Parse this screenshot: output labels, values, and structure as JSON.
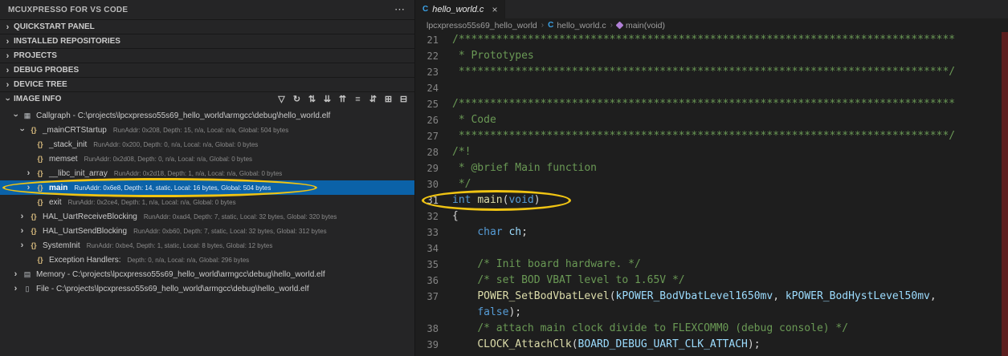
{
  "colors": {
    "selection_blue": "#0b62a8",
    "annotation_yellow": "#f0c413",
    "comment_green": "#6a9955",
    "keyword_blue": "#569cd6",
    "function_yellow": "#dcdcaa",
    "variable_blue": "#9cdcfe",
    "overview_strip_red": "#5c1f1f"
  },
  "sidebar": {
    "title": "MCUXPRESSO FOR VS CODE",
    "more_actions": "⋯",
    "sections": [
      {
        "label": "QUICKSTART PANEL",
        "expanded": false
      },
      {
        "label": "INSTALLED REPOSITORIES",
        "expanded": false
      },
      {
        "label": "PROJECTS",
        "expanded": false
      },
      {
        "label": "DEBUG PROBES",
        "expanded": false
      },
      {
        "label": "DEVICE TREE",
        "expanded": false
      },
      {
        "label": "IMAGE INFO",
        "expanded": true
      }
    ],
    "image_info_toolbar": [
      {
        "name": "filter-icon",
        "glyph": "▽"
      },
      {
        "name": "refresh-icon",
        "glyph": "↻"
      },
      {
        "name": "sort-by-address-icon",
        "glyph": "⇅"
      },
      {
        "name": "sort-descending-icon",
        "glyph": "⇊"
      },
      {
        "name": "sort-ascending-icon",
        "glyph": "⇈"
      },
      {
        "name": "flat-view-icon",
        "glyph": "≡"
      },
      {
        "name": "toggle-sort-icon",
        "glyph": "⇵"
      },
      {
        "name": "expand-all-icon",
        "glyph": "⊞"
      },
      {
        "name": "collapse-all-icon",
        "glyph": "⊟"
      }
    ],
    "tree": [
      {
        "depth": 0,
        "chevron": "expanded",
        "icon": "callgraph",
        "label": "Callgraph - C:\\projects\\lpcxpresso55s69_hello_world\\armgcc\\debug\\hello_world.elf",
        "detail": ""
      },
      {
        "depth": 1,
        "chevron": "expanded",
        "icon": "braces",
        "label": "_mainCRTStartup",
        "detail": "RunAddr: 0x208, Depth: 15, n/a, Local: n/a, Global: 504 bytes"
      },
      {
        "depth": 2,
        "chevron": "none",
        "icon": "braces",
        "label": "_stack_init",
        "detail": "RunAddr: 0x200, Depth: 0, n/a, Local: n/a, Global: 0 bytes"
      },
      {
        "depth": 2,
        "chevron": "none",
        "icon": "braces",
        "label": "memset",
        "detail": "RunAddr: 0x2d08, Depth: 0, n/a, Local: n/a, Global: 0 bytes"
      },
      {
        "depth": 2,
        "chevron": "collapsed",
        "icon": "braces",
        "label": "__libc_init_array",
        "detail": "RunAddr: 0x2d18, Depth: 1, n/a, Local: n/a, Global: 0 bytes"
      },
      {
        "depth": 2,
        "chevron": "collapsed",
        "icon": "braces",
        "label": "main",
        "detail": "RunAddr: 0x6e8, Depth: 14, static, Local: 16 bytes, Global: 504 bytes",
        "selected": true,
        "annotated": true
      },
      {
        "depth": 2,
        "chevron": "none",
        "icon": "braces",
        "label": "exit",
        "detail": "RunAddr: 0x2ce4, Depth: 1, n/a, Local: n/a, Global: 0 bytes"
      },
      {
        "depth": 1,
        "chevron": "collapsed",
        "icon": "braces",
        "label": "HAL_UartReceiveBlocking",
        "detail": "RunAddr: 0xad4, Depth: 7, static, Local: 32 bytes, Global: 320 bytes"
      },
      {
        "depth": 1,
        "chevron": "collapsed",
        "icon": "braces",
        "label": "HAL_UartSendBlocking",
        "detail": "RunAddr: 0xb60, Depth: 7, static, Local: 32 bytes, Global: 312 bytes"
      },
      {
        "depth": 1,
        "chevron": "collapsed",
        "icon": "braces",
        "label": "SystemInit",
        "detail": "RunAddr: 0xbe4, Depth: 1, static, Local: 8 bytes, Global: 12 bytes"
      },
      {
        "depth": 2,
        "chevron": "none",
        "icon": "braces",
        "label": "Exception Handlers:",
        "detail": "Depth: 0, n/a, Local: n/a, Global: 296 bytes"
      },
      {
        "depth": 0,
        "chevron": "collapsed",
        "icon": "memory",
        "label": "Memory - C:\\projects\\lpcxpresso55s69_hello_world\\armgcc\\debug\\hello_world.elf",
        "detail": ""
      },
      {
        "depth": 0,
        "chevron": "collapsed",
        "icon": "file",
        "label": "File - C:\\projects\\lpcxpresso55s69_hello_world\\armgcc\\debug\\hello_world.elf",
        "detail": ""
      }
    ]
  },
  "editor": {
    "tab": {
      "icon": "C",
      "label": "hello_world.c",
      "close": "×"
    },
    "breadcrumb": [
      {
        "icon": "none",
        "label": "lpcxpresso55s69_hello_world"
      },
      {
        "icon": "c",
        "label": "hello_world.c"
      },
      {
        "icon": "method",
        "label": "main(void)"
      }
    ],
    "lines": [
      {
        "num": "21",
        "tokens": [
          [
            "cm",
            "/*******************************************************************************"
          ]
        ]
      },
      {
        "num": "22",
        "tokens": [
          [
            "cm",
            " * Prototypes"
          ]
        ]
      },
      {
        "num": "23",
        "tokens": [
          [
            "cm",
            " ******************************************************************************/"
          ]
        ]
      },
      {
        "num": "24",
        "tokens": []
      },
      {
        "num": "25",
        "tokens": [
          [
            "cm",
            "/*******************************************************************************"
          ]
        ]
      },
      {
        "num": "26",
        "tokens": [
          [
            "cm",
            " * Code"
          ]
        ]
      },
      {
        "num": "27",
        "tokens": [
          [
            "cm",
            " ******************************************************************************/"
          ]
        ]
      },
      {
        "num": "28",
        "tokens": [
          [
            "cm",
            "/*!"
          ]
        ]
      },
      {
        "num": "29",
        "tokens": [
          [
            "cm",
            " * @brief Main function"
          ]
        ]
      },
      {
        "num": "30",
        "tokens": [
          [
            "cm",
            " */"
          ]
        ]
      },
      {
        "num": "31",
        "current": true,
        "annotated": true,
        "tokens": [
          [
            "kw",
            "int"
          ],
          [
            "df",
            " "
          ],
          [
            "fn",
            "main"
          ],
          [
            "df",
            "("
          ],
          [
            "kw",
            "void"
          ],
          [
            "df",
            ")"
          ]
        ]
      },
      {
        "num": "32",
        "tokens": [
          [
            "df",
            "{"
          ]
        ]
      },
      {
        "num": "33",
        "tokens": [
          [
            "df",
            "    "
          ],
          [
            "kw",
            "char"
          ],
          [
            "df",
            " "
          ],
          [
            "var",
            "ch"
          ],
          [
            "df",
            ";"
          ]
        ]
      },
      {
        "num": "34",
        "tokens": []
      },
      {
        "num": "35",
        "tokens": [
          [
            "df",
            "    "
          ],
          [
            "cm",
            "/* Init board hardware. */"
          ]
        ]
      },
      {
        "num": "36",
        "tokens": [
          [
            "df",
            "    "
          ],
          [
            "cm",
            "/* set BOD VBAT level to 1.65V */"
          ]
        ]
      },
      {
        "num": "37",
        "tokens": [
          [
            "df",
            "    "
          ],
          [
            "fn",
            "POWER_SetBodVbatLevel"
          ],
          [
            "df",
            "("
          ],
          [
            "var",
            "kPOWER_BodVbatLevel1650mv"
          ],
          [
            "df",
            ", "
          ],
          [
            "var",
            "kPOWER_BodHystLevel50mv"
          ],
          [
            "df",
            ","
          ]
        ]
      },
      {
        "num": "",
        "wrap": true,
        "tokens": [
          [
            "df",
            "    "
          ],
          [
            "kw",
            "false"
          ],
          [
            "df",
            ");"
          ]
        ]
      },
      {
        "num": "38",
        "tokens": [
          [
            "df",
            "    "
          ],
          [
            "cm",
            "/* attach main clock divide to FLEXCOMM0 (debug console) */"
          ]
        ]
      },
      {
        "num": "39",
        "tokens": [
          [
            "df",
            "    "
          ],
          [
            "fn",
            "CLOCK_AttachClk"
          ],
          [
            "df",
            "("
          ],
          [
            "var",
            "BOARD_DEBUG_UART_CLK_ATTACH"
          ],
          [
            "df",
            ");"
          ]
        ]
      }
    ]
  }
}
